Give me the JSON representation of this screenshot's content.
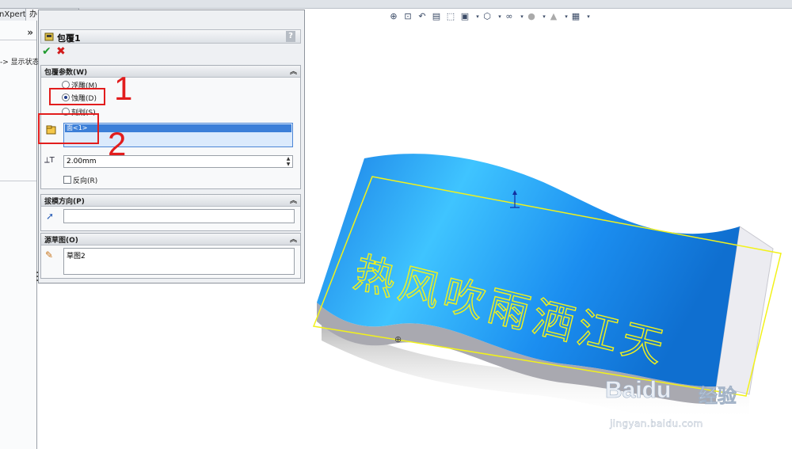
{
  "tabs": {
    "xpert": "nXpert",
    "office": "办公室产品"
  },
  "tree": {
    "item": "-> 显示状态"
  },
  "property_manager": {
    "title": "包覆1",
    "help": "?",
    "ok_symbol": "✔",
    "cancel_symbol": "✖",
    "wrap_group": {
      "title": "包覆参数(W)",
      "options": [
        "浮雕(M)",
        "蚀雕(D)",
        "刻划(S)"
      ],
      "selected": "蚀雕(D)",
      "selection_item": "面<1>",
      "thickness": "2.00mm",
      "reverse_label": "反向(R)"
    },
    "draft_group": {
      "title": "拔模方向(P)",
      "value": ""
    },
    "sketch_group": {
      "title": "源草图(O)",
      "value": "草图2"
    }
  },
  "annotations": {
    "label_1": "1",
    "label_2": "2"
  },
  "graphics": {
    "engraved_text": "热风吹雨洒江天",
    "origin_marker": "⊕"
  },
  "watermark": {
    "brand": "Baidu",
    "cn": "经验",
    "url": "jingyan.baidu.com"
  },
  "colors": {
    "surface_blue": "#1b8ef0",
    "highlight_yellow": "#f2f21a",
    "annotation_red": "#e21d1d",
    "ok_green": "#1f9a2e",
    "selection_blue": "#3c7fd8"
  }
}
